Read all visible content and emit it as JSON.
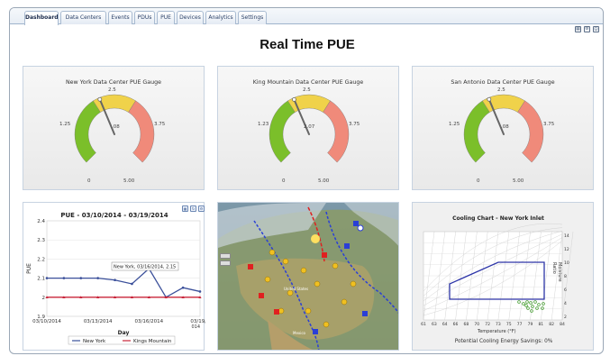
{
  "tabs": [
    {
      "label": "Dashboard",
      "active": true
    },
    {
      "label": "Data Centers"
    },
    {
      "label": "Events"
    },
    {
      "label": "PDUs"
    },
    {
      "label": "PUE"
    },
    {
      "label": "Devices"
    },
    {
      "label": "Analytics"
    },
    {
      "label": "Settings"
    }
  ],
  "toolbar_icons": [
    "grid-icon",
    "settings-icon",
    "print-icon"
  ],
  "page_title": "Real Time PUE",
  "gauges": [
    {
      "title": "New York Data Center PUE Gauge",
      "value_label": ".08",
      "value": 2.08,
      "min_label": "0",
      "max_label": "5.00",
      "q1_label": "1.25",
      "mid_label": "2.5",
      "q3_label": "3.75"
    },
    {
      "title": "King Mountain Data Center PUE Gauge",
      "value_label": "2.07",
      "value": 2.07,
      "min_label": "0",
      "max_label": "5.00",
      "q1_label": "1.23",
      "mid_label": "2.5",
      "q3_label": "3.75"
    },
    {
      "title": "San Antonio Data Center PUE Gauge",
      "value_label": ".08",
      "value": 2.08,
      "min_label": "0",
      "max_label": "5.00",
      "q1_label": "1.25",
      "mid_label": "2.5",
      "q3_label": "3.75"
    }
  ],
  "colors": {
    "green": "#7bbf2a",
    "yellow": "#f0d24a",
    "red": "#f08a7a",
    "ny_line": "#3a4f9a",
    "km_line": "#c8243a"
  },
  "chart_data": {
    "type": "line",
    "title": "PUE - 03/10/2014 - 03/19/2014",
    "xlabel": "Day",
    "ylabel": "PUE",
    "ylim": [
      1.9,
      2.4
    ],
    "yticks": [
      "2.4",
      "2.3",
      "2.2",
      "2.1",
      "2",
      "1.9"
    ],
    "xtick_labels": [
      "03/10/2014",
      "03/13/2014",
      "03/16/2014",
      "03/19/2"
    ],
    "xtick_extra": "014",
    "x": [
      0,
      1,
      2,
      3,
      4,
      5,
      6,
      7,
      8,
      9
    ],
    "series": [
      {
        "name": "New York",
        "values": [
          2.1,
          2.1,
          2.1,
          2.1,
          2.09,
          2.07,
          2.15,
          2.0,
          2.05,
          2.03
        ]
      },
      {
        "name": "Kings Mountain",
        "values": [
          2.0,
          2.0,
          2.0,
          2.0,
          2.0,
          2.0,
          2.0,
          2.0,
          2.0,
          2.0
        ]
      }
    ],
    "tooltip": "New York, 03/16/2014, 2.15",
    "legend_position": "bottom"
  },
  "map": {
    "labels": [
      "United States",
      "Mexico"
    ]
  },
  "cooling": {
    "title": "Cooling Chart - New York Inlet",
    "xlabel": "Temperature (°F)",
    "ylabel": "Moisture Ratio",
    "xticks": [
      "61",
      "63",
      "64",
      "66",
      "68",
      "70",
      "72",
      "73",
      "75",
      "77",
      "79",
      "81",
      "82",
      "84"
    ],
    "yticks": [
      "14",
      "12",
      "10",
      "8",
      "6",
      "4",
      "2"
    ],
    "savings": "Potential Cooling Energy Savings: 0%"
  }
}
